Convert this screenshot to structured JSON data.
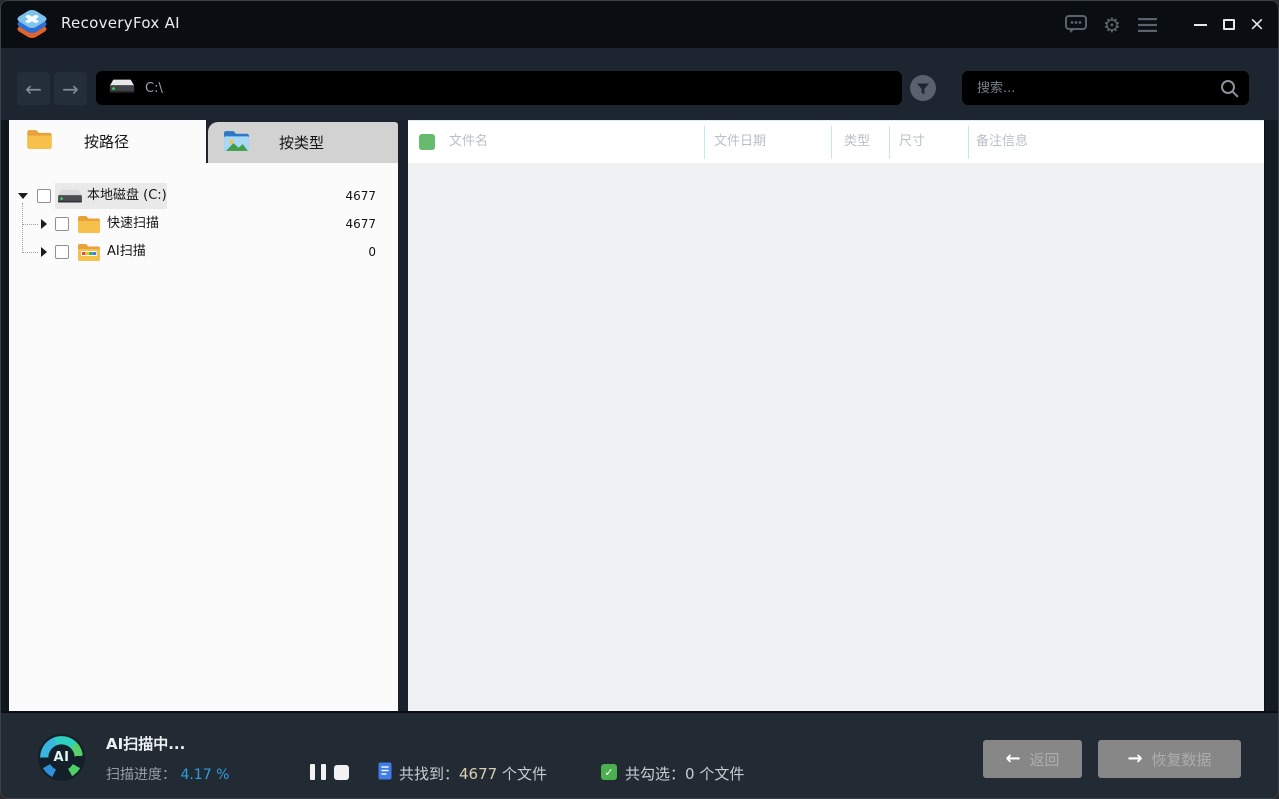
{
  "window": {
    "title": "RecoveryFox AI"
  },
  "toolbar": {
    "path_value": "C:\\",
    "search_placeholder": "搜索..."
  },
  "sidebar": {
    "tabs": [
      {
        "label": "按路径"
      },
      {
        "label": "按类型"
      }
    ],
    "tree": [
      {
        "label": "本地磁盘 (C:)",
        "count": "4677"
      },
      {
        "label": "快速扫描",
        "count": "4677"
      },
      {
        "label": "AI扫描",
        "count": "0"
      }
    ]
  },
  "main": {
    "columns": [
      "文件名",
      "文件日期",
      "类型",
      "尺寸",
      "备注信息"
    ]
  },
  "statusbar": {
    "scan_title": "AI扫描中...",
    "progress_label": "扫描进度：",
    "progress_value": "4.17 %",
    "found_label": "共找到：",
    "found_number": "4677",
    "found_suffix": " 个文件",
    "checked_label": "共勾选：",
    "checked_number": "0",
    "checked_suffix": " 个文件",
    "checkmark": "✓",
    "ai_badge": "AI",
    "back_label": "返回",
    "recover_label": "恢复数据"
  },
  "colors": {
    "accent_blue": "#2e9fe0",
    "check_green": "#4caf50",
    "header_green": "#68ba6f",
    "folder_orange": "#f7c04a",
    "titlebar_bg": "#0a0d11",
    "toolbar_bg": "#1c2530",
    "statusbar_bg": "#222b34"
  }
}
